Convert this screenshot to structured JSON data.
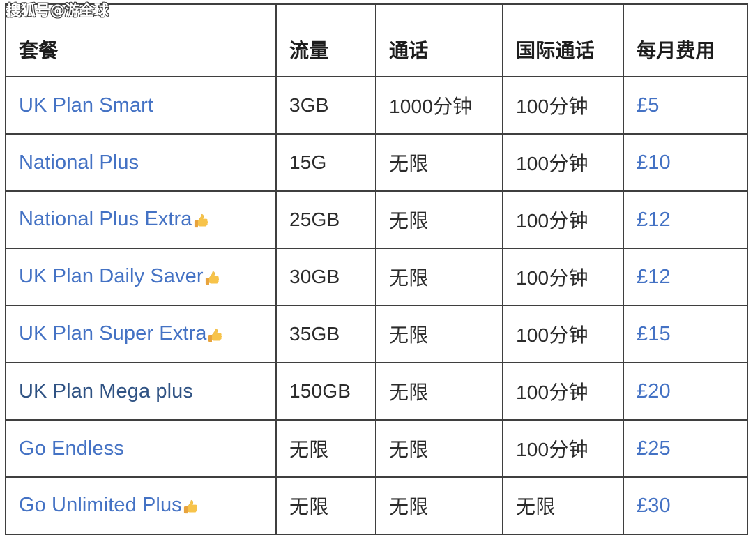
{
  "watermark": {
    "text": "搜狐号@游全球"
  },
  "table": {
    "columns": [
      {
        "key": "plan",
        "label": "套餐"
      },
      {
        "key": "data",
        "label": "流量"
      },
      {
        "key": "call",
        "label": "通话"
      },
      {
        "key": "intl",
        "label": "国际通话"
      },
      {
        "key": "price",
        "label": "每月费用"
      }
    ],
    "rows": [
      {
        "plan": "UK Plan Smart",
        "plan_style": "link",
        "recommended": false,
        "data": "3GB",
        "call": "1000分钟",
        "intl": "100分钟",
        "price": "£5"
      },
      {
        "plan": "National Plus",
        "plan_style": "link",
        "recommended": false,
        "data": "15G",
        "call": "无限",
        "intl": "100分钟",
        "price": "£10"
      },
      {
        "plan": "National Plus Extra",
        "plan_style": "link",
        "recommended": true,
        "data": "25GB",
        "call": "无限",
        "intl": "100分钟",
        "price": "£12"
      },
      {
        "plan": "UK Plan Daily Saver",
        "plan_style": "link",
        "recommended": true,
        "data": "30GB",
        "call": "无限",
        "intl": "100分钟",
        "price": "£12"
      },
      {
        "plan": "UK Plan Super Extra",
        "plan_style": "link",
        "recommended": true,
        "data": "35GB",
        "call": "无限",
        "intl": "100分钟",
        "price": "£15"
      },
      {
        "plan": "UK Plan Mega plus",
        "plan_style": "dark",
        "recommended": false,
        "data": "150GB",
        "call": "无限",
        "intl": "100分钟",
        "price": "£20"
      },
      {
        "plan": "Go Endless",
        "plan_style": "link",
        "recommended": false,
        "data": "无限",
        "call": "无限",
        "intl": "100分钟",
        "price": "£25"
      },
      {
        "plan": "Go Unlimited Plus",
        "plan_style": "link",
        "recommended": true,
        "data": "无限",
        "call": "无限",
        "intl": "无限",
        "price": "£30"
      }
    ]
  },
  "colors": {
    "link_blue": "#4472c4",
    "dark_blue": "#2f5283",
    "border": "#3f3f3f",
    "text": "#2b2b2b",
    "background": "#ffffff"
  },
  "icons": {
    "thumbs_up": "thumbs-up-icon"
  }
}
